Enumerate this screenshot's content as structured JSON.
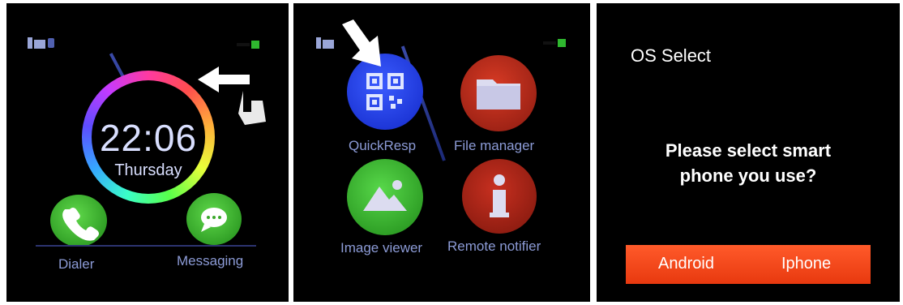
{
  "panel1": {
    "time": "22:06",
    "day": "Thursday",
    "apps": [
      {
        "label": "Dialer"
      },
      {
        "label": "Messaging"
      }
    ],
    "icons": {
      "status_left": "battery-bluetooth-icon",
      "status_right": "battery-level-icon",
      "swipe": "swipe-left-hand-icon"
    }
  },
  "panel2": {
    "apps": [
      {
        "label": "QuickResp",
        "icon": "qr-code-icon",
        "color": "#1d3ef0"
      },
      {
        "label": "File manager",
        "icon": "folder-icon",
        "color": "#b0261a"
      },
      {
        "label": "Image viewer",
        "icon": "image-icon",
        "color": "#2fa82f"
      },
      {
        "label": "Remote notifier",
        "icon": "info-icon",
        "color": "#9d1e12"
      }
    ],
    "icons": {
      "pointer": "pointer-arrow-icon"
    }
  },
  "panel3": {
    "title": "OS Select",
    "question_line1": "Please select smart",
    "question_line2": "phone you use?",
    "options": [
      {
        "label": "Android"
      },
      {
        "label": "Iphone"
      }
    ],
    "accent": "#f24a1b"
  }
}
